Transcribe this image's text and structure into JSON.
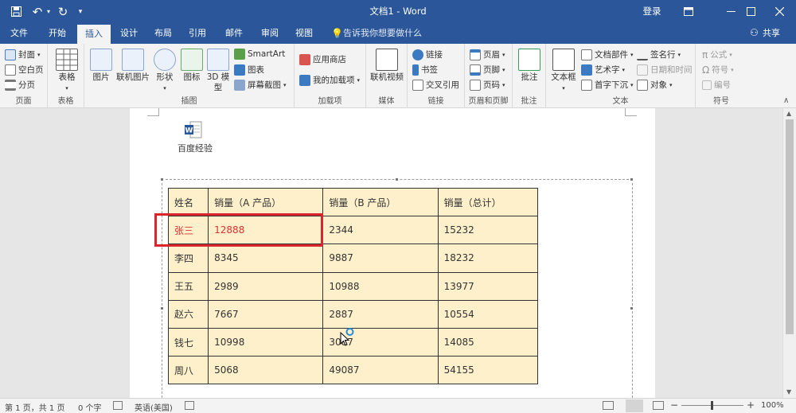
{
  "titlebar": {
    "title": "文档1 - Word",
    "login": "登录"
  },
  "tabs": [
    {
      "label": "文件"
    },
    {
      "label": "开始"
    },
    {
      "label": "插入"
    },
    {
      "label": "设计"
    },
    {
      "label": "布局"
    },
    {
      "label": "引用"
    },
    {
      "label": "邮件"
    },
    {
      "label": "审阅"
    },
    {
      "label": "视图"
    }
  ],
  "tell_me": "告诉我你想要做什么",
  "share": "共享",
  "ribbon": {
    "pages": {
      "cover": "封面",
      "blank": "空白页",
      "break": "分页",
      "label": "页面"
    },
    "tables": {
      "table": "表格",
      "label": "表格"
    },
    "illustrations": {
      "picture": "图片",
      "online_picture": "联机图片",
      "shapes": "形状",
      "icons": "图标",
      "model_a": "3D 模",
      "model_b": "型",
      "smartart": "SmartArt",
      "chart": "图表",
      "screenshot": "屏幕截图",
      "label": "插图"
    },
    "addins": {
      "store": "应用商店",
      "my_addins": "我的加载项",
      "label": "加载项"
    },
    "media": {
      "online_video": "联机视频",
      "label": "媒体"
    },
    "links": {
      "link": "链接",
      "bookmark": "书签",
      "cross_ref": "交叉引用",
      "label": "链接"
    },
    "header_footer": {
      "header": "页眉",
      "footer": "页脚",
      "page_number": "页码",
      "label": "页眉和页脚"
    },
    "comments": {
      "comment": "批注",
      "label": "批注"
    },
    "text": {
      "textbox": "文本框",
      "quick_parts": "文档部件",
      "wordart": "艺术字",
      "dropcap": "首字下沉",
      "signature": "签名行",
      "datetime": "日期和时间",
      "object": "对象",
      "label": "文本"
    },
    "symbols": {
      "equation": "公式",
      "symbol": "符号",
      "number": "编号",
      "label": "符号"
    }
  },
  "document": {
    "icon_caption": "百度经验",
    "table": {
      "headers": [
        "姓名",
        "销量（A 产品）",
        "销量（B 产品）",
        "销量（总计）"
      ],
      "rows": [
        [
          "张三",
          "12888",
          "2344",
          "15232"
        ],
        [
          "李四",
          "8345",
          "9887",
          "18232"
        ],
        [
          "王五",
          "2989",
          "10988",
          "13977"
        ],
        [
          "赵六",
          "7667",
          "2887",
          "10554"
        ],
        [
          "钱七",
          "10998",
          "3087",
          "14085"
        ],
        [
          "周八",
          "5068",
          "49087",
          "54155"
        ]
      ]
    }
  },
  "status": {
    "page": "第 1 页，共 1 页",
    "words": "0 个字",
    "language": "英语(美国)",
    "zoom": "100%"
  },
  "colors": {
    "accent": "#2b579a",
    "table_fill": "#fdf0cb",
    "highlight": "#e03030"
  }
}
